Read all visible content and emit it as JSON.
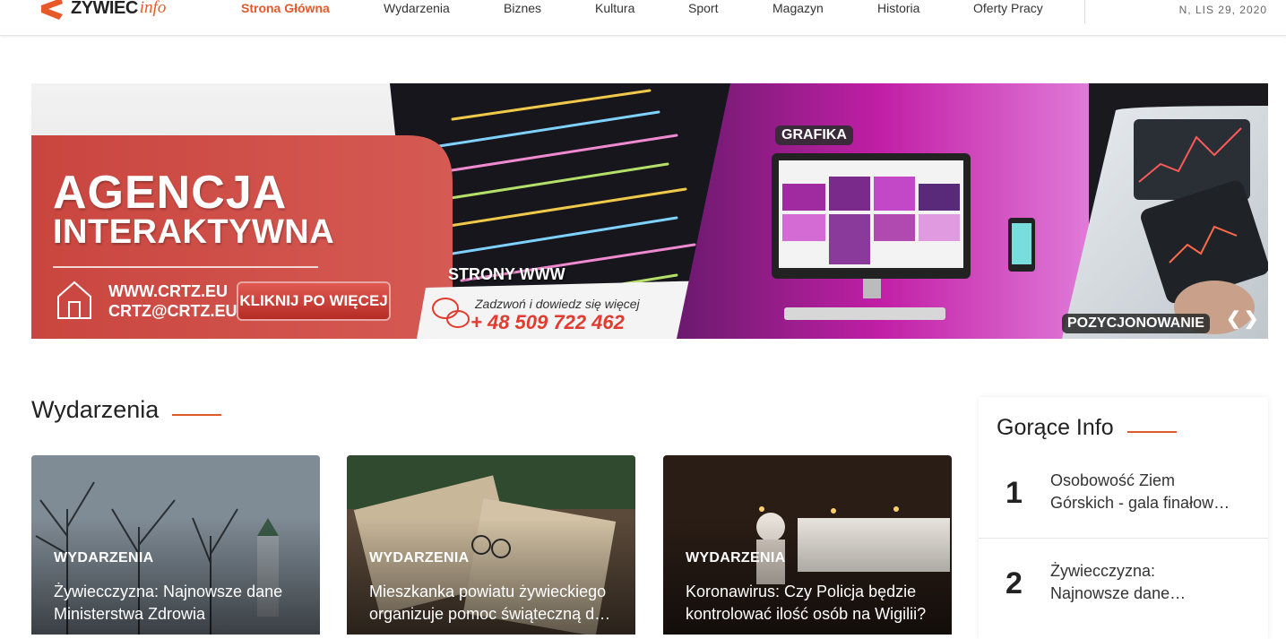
{
  "header": {
    "logo_word": "ŻYWIEC",
    "logo_info": "info",
    "nav": [
      {
        "label": "Strona Główna",
        "active": true
      },
      {
        "label": "Wydarzenia",
        "active": false
      },
      {
        "label": "Biznes",
        "active": false
      },
      {
        "label": "Kultura",
        "active": false
      },
      {
        "label": "Sport",
        "active": false
      },
      {
        "label": "Magazyn",
        "active": false
      },
      {
        "label": "Historia",
        "active": false
      },
      {
        "label": "Oferty Pracy",
        "active": false
      }
    ],
    "date": "N, LIS 29, 2020"
  },
  "banner": {
    "title_line1": "AGENCJA",
    "title_line2": "INTERAKTYWNA",
    "url": "WWW.CRTZ.EU",
    "email": "CRTZ@CRTZ.EU",
    "cta": "KLIKNIJ PO WIĘCEJ",
    "www_label": "STRONY WWW",
    "call_text": "Zadzwoń i dowiedz się więcej",
    "phone": "+ 48 509 722 462",
    "grafika_label": "GRAFIKA",
    "pozycjonowanie_label": "POZYCJONOWANIE"
  },
  "events": {
    "title": "Wydarzenia",
    "cards": [
      {
        "category": "WYDARZENIA",
        "title": "Żywiecczyzna: Najnowsze dane Ministerstwa Zdrowia"
      },
      {
        "category": "WYDARZENIA",
        "title": "Mieszkanka powiatu żywieckiego organizuje pomoc świąteczną d…"
      },
      {
        "category": "WYDARZENIA",
        "title": "Koronawirus: Czy Policja będzie kontrolować ilość osób na Wigilii?"
      }
    ]
  },
  "hot": {
    "title": "Gorące Info",
    "items": [
      {
        "rank": "1",
        "title": "Osobowość Ziem Górskich - gala finałow…"
      },
      {
        "rank": "2",
        "title": "Żywiecczyzna: Najnowsze dane…"
      }
    ]
  },
  "colors": {
    "accent": "#e05a2b",
    "banner_red": "#c9463f",
    "phone_red": "#e23b2f"
  }
}
